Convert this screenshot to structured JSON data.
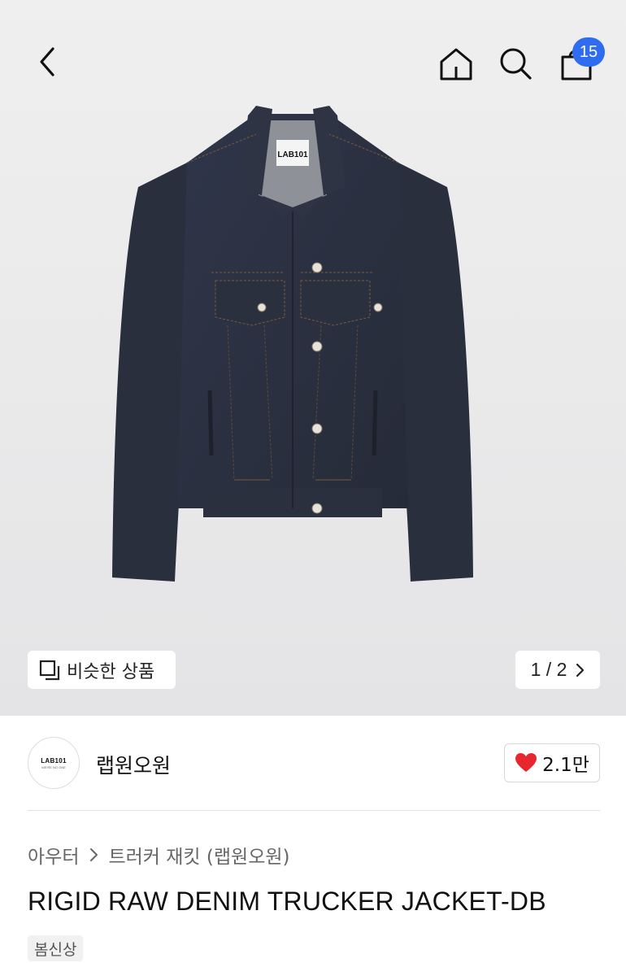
{
  "header": {
    "cart_count": "15",
    "icons": [
      "back-arrow-icon",
      "home-icon",
      "search-icon",
      "shopping-bag-icon"
    ]
  },
  "gallery": {
    "similar_label": "비슷한 상품",
    "pager_text": "1 / 2",
    "label_on_product": "LAB101"
  },
  "brand": {
    "logo_text": "LAB101",
    "logo_subtext": "WE'RE NO ONE",
    "name": "랩원오원",
    "likes": "2.1만"
  },
  "product": {
    "breadcrumb_category": "아우터",
    "breadcrumb_sub": "트러커 재킷 (랩원오원)",
    "title": "RIGID RAW DENIM TRUCKER JACKET-DB",
    "tag": "봄신상"
  },
  "colors": {
    "badge": "#2f6cf0",
    "heart": "#e8262e",
    "denim": "#2c3240"
  }
}
